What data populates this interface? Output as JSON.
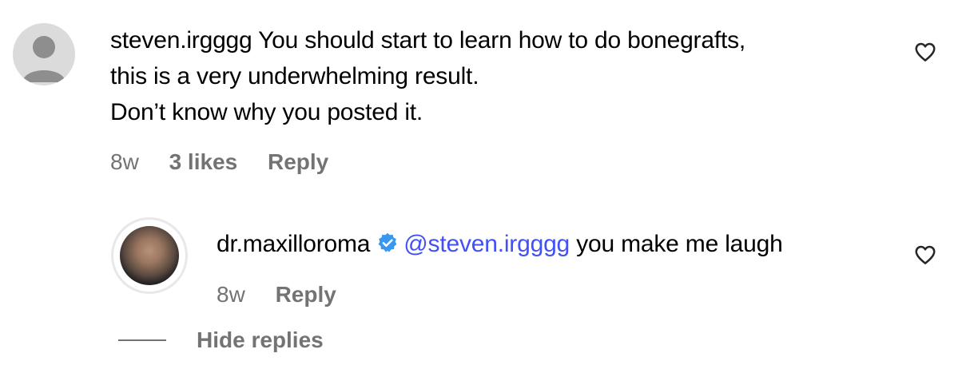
{
  "comments": [
    {
      "username": "steven.irgggg",
      "lines": [
        "You should start to learn how to do bonegrafts,",
        "this is a very underwhelming result.",
        "Don’t know why you posted it."
      ],
      "time": "8w",
      "likes": "3 likes",
      "reply_label": "Reply"
    }
  ],
  "reply": {
    "username": "dr.maxilloroma",
    "mention": "@steven.irgggg",
    "text": "you make me laugh",
    "time": "8w",
    "reply_label": "Reply"
  },
  "hide_replies_label": "Hide replies",
  "colors": {
    "mention": "#4150f7",
    "meta": "#737373",
    "verified": "#3897f0"
  },
  "icons": [
    "default-avatar-icon",
    "heart-icon",
    "verified-badge-icon"
  ]
}
